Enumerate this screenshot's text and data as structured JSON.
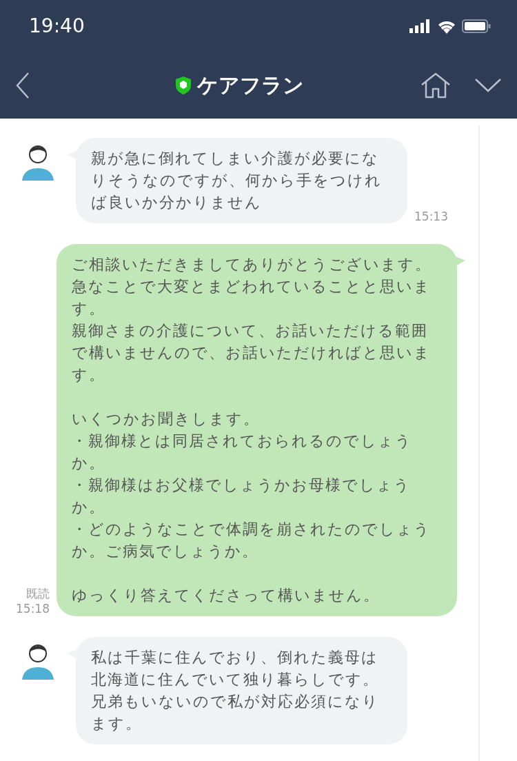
{
  "status_bar": {
    "time": "19:40"
  },
  "header": {
    "title": "ケアフラン"
  },
  "messages": [
    {
      "kind": "incoming",
      "blocks": [
        [
          "親が急に倒れてしまい介護が必要になりそうなのですが、何から手をつければ良いか分かりません"
        ]
      ],
      "time": "15:13"
    },
    {
      "kind": "outgoing",
      "blocks": [
        [
          "ご相談いただきましてありがとうございます。",
          "急なことで大変とまどわれていることと思います。",
          "親御さまの介護について、お話いただける範囲で構いませんので、お話いただければと思います。"
        ],
        [
          "いくつかお聞きします。",
          "・親御様とは同居されておられるのでしょうか。",
          "・親御様はお父様でしょうかお母様でしょうか。",
          "・どのようなことで体調を崩されたのでしょうか。ご病気でしょうか。"
        ],
        [
          "ゆっくり答えてくださって構いません。"
        ]
      ],
      "read_label": "既読",
      "time": "15:18"
    },
    {
      "kind": "incoming",
      "blocks": [
        [
          "私は千葉に住んでおり、倒れた義母は北海道に住んでいて独り暮らしです。",
          "兄弟もいないので私が対応必須になります。"
        ]
      ]
    }
  ]
}
